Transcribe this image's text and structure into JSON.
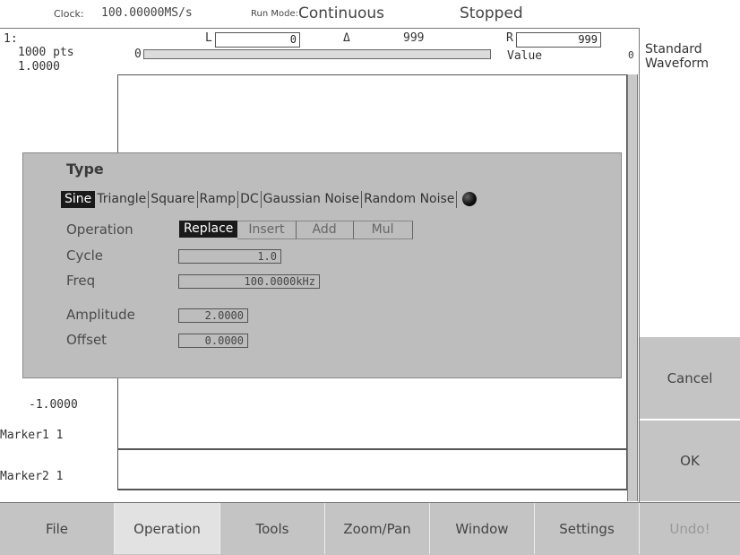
{
  "status": {
    "clock_label": "Clock:",
    "clock_value": "100.00000MS/s",
    "run_mode_label": "Run Mode:",
    "run_mode_value": "Continuous",
    "state": "Stopped"
  },
  "graph": {
    "channel": "1:",
    "points": "1000 pts",
    "y_max": "1.0000",
    "y_min": "-1.0000",
    "left_cursor": {
      "label": "L",
      "value": "0",
      "value_label": "Value"
    },
    "delta": {
      "label": "Δ",
      "value": "999",
      "bar_start": "0"
    },
    "right_cursor": {
      "label": "R",
      "value": "999",
      "value_label": "Value",
      "end": "0"
    },
    "marker1": "Marker1  1",
    "marker2": "Marker2  1"
  },
  "dialog": {
    "title": "Type",
    "types": [
      "Sine",
      "Triangle",
      "Square",
      "Ramp",
      "DC",
      "Gaussian Noise",
      "Random Noise"
    ],
    "selected_type": "Sine",
    "operation_label": "Operation",
    "operations": [
      "Replace",
      "Insert",
      "Add",
      "Mul"
    ],
    "selected_operation": "Replace",
    "cycle_label": "Cycle",
    "cycle_value": "1.0",
    "freq_label": "Freq",
    "freq_value": "100.0000kHz",
    "amplitude_label": "Amplitude",
    "amplitude_value": "2.0000",
    "offset_label": "Offset",
    "offset_value": "0.0000",
    "knob_icon": "knob-icon"
  },
  "side_panel": {
    "title_line1": "Standard",
    "title_line2": "Waveform",
    "cancel_label": "Cancel",
    "ok_label": "OK"
  },
  "menu": {
    "items": [
      "File",
      "Operation",
      "Tools",
      "Zoom/Pan",
      "Window",
      "Settings",
      "Undo!"
    ],
    "active": "Operation",
    "disabled": "Undo!"
  }
}
